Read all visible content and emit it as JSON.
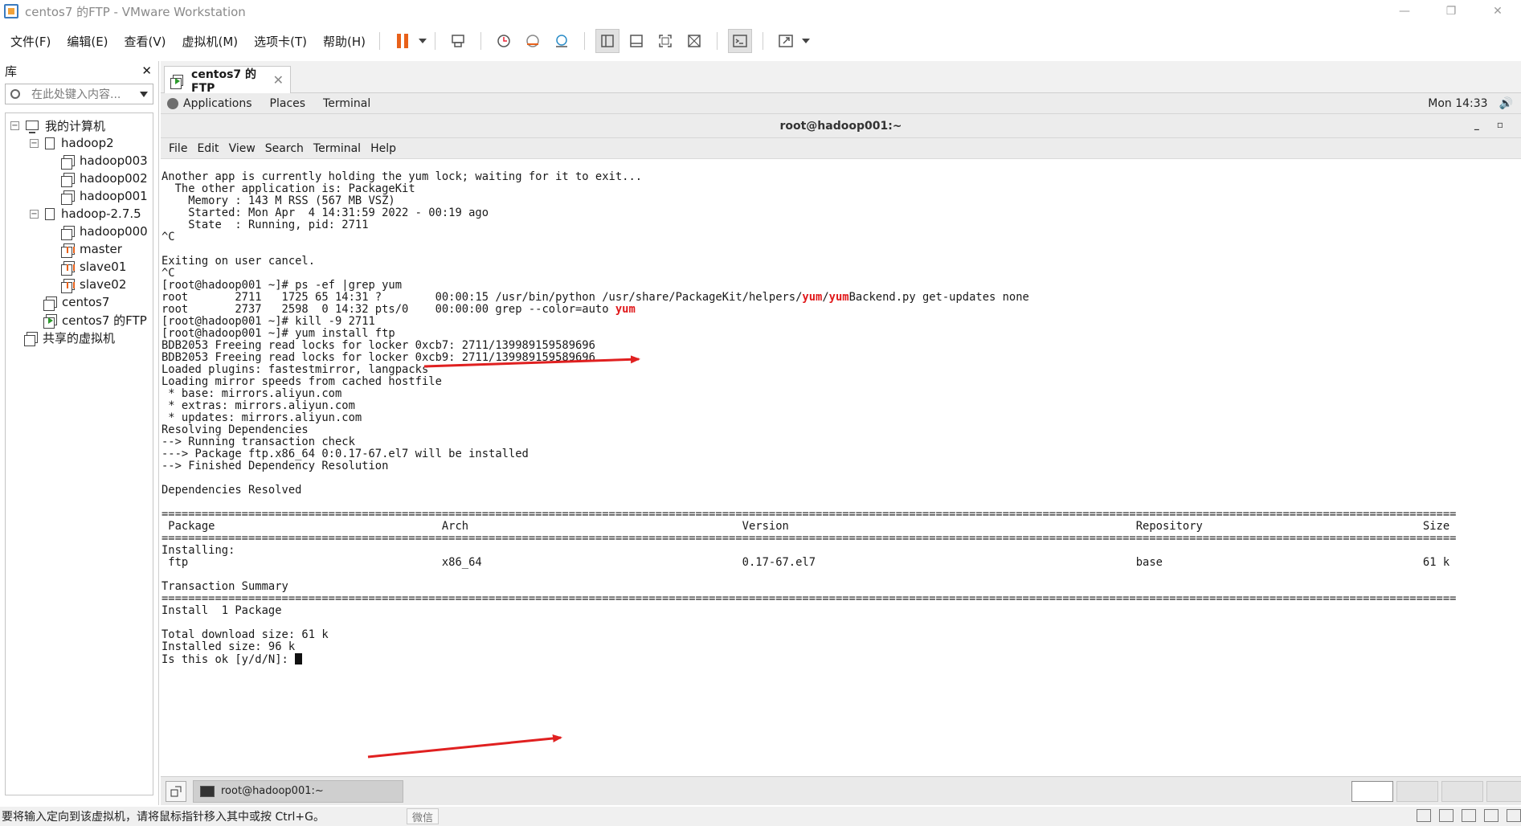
{
  "window": {
    "title": "centos7 的FTP - VMware Workstation",
    "minimize": "—",
    "restore": "❐",
    "close": "✕"
  },
  "menu": {
    "items": [
      "文件(F)",
      "编辑(E)",
      "查看(V)",
      "虚拟机(M)",
      "选项卡(T)",
      "帮助(H)"
    ]
  },
  "toolbar": {
    "icons": [
      "pause-icon",
      "send-ctrl-alt-del-icon",
      "snapshot-icon",
      "revert-snapshot-icon",
      "snapshot-manager-icon",
      "library-view-icon",
      "thumbnail-bar-icon",
      "fullscreen-icon",
      "unity-icon",
      "console-view-icon",
      "stretch-icon"
    ]
  },
  "library": {
    "title": "库",
    "close": "✕",
    "search_placeholder": "在此处键入内容...",
    "tree": {
      "root": "我的计算机",
      "groups": [
        {
          "label": "hadoop2",
          "items": [
            "hadoop003",
            "hadoop002",
            "hadoop001"
          ]
        },
        {
          "label": "hadoop-2.7.5",
          "items": [
            "hadoop000",
            "master",
            "slave01",
            "slave02"
          ]
        }
      ],
      "loose": [
        "centos7",
        "centos7 的FTP"
      ],
      "shared": "共享的虚拟机"
    }
  },
  "tab": {
    "label": "centos7 的FTP",
    "close": "✕"
  },
  "guest": {
    "top_bar": {
      "applications": "Applications",
      "places": "Places",
      "terminal": "Terminal",
      "clock": "Mon 14:33",
      "volume": "🔊"
    },
    "terminal_window": {
      "title": "root@hadoop001:~",
      "minimize": "_",
      "maximize": "▫",
      "menu": [
        "File",
        "Edit",
        "View",
        "Search",
        "Terminal",
        "Help"
      ]
    },
    "terminal_lines": {
      "l1": "Another app is currently holding the yum lock; waiting for it to exit...",
      "l2": "  The other application is: PackageKit",
      "l3": "    Memory : 143 M RSS (567 MB VSZ)",
      "l4": "    Started: Mon Apr  4 14:31:59 2022 - 00:19 ago",
      "l5": "    State  : Running, pid: 2711",
      "l6": "^C",
      "l7": "",
      "l8": "Exiting on user cancel.",
      "l9": "^C",
      "l10": "[root@hadoop001 ~]# ps -ef |grep yum",
      "l11a": "root       2711   1725 65 14:31 ?        00:00:15 /usr/bin/python /usr/share/PackageKit/helpers/",
      "l11b": "yum",
      "l11c": "/",
      "l11d": "yum",
      "l11e": "Backend.py get-updates none",
      "l12a": "root       2737   2598  0 14:32 pts/0    00:00:00 grep --color=auto ",
      "l12b": "yum",
      "l13": "[root@hadoop001 ~]# kill -9 2711",
      "l14": "[root@hadoop001 ~]# yum install ftp",
      "l15": "BDB2053 Freeing read locks for locker 0xcb7: 2711/139989159589696",
      "l16": "BDB2053 Freeing read locks for locker 0xcb9: 2711/139989159589696",
      "l17": "Loaded plugins: fastestmirror, langpacks",
      "l18": "Loading mirror speeds from cached hostfile",
      "l19": " * base: mirrors.aliyun.com",
      "l20": " * extras: mirrors.aliyun.com",
      "l21": " * updates: mirrors.aliyun.com",
      "l22": "Resolving Dependencies",
      "l23": "--> Running transaction check",
      "l24": "---> Package ftp.x86_64 0:0.17-67.el7 will be installed",
      "l25": "--> Finished Dependency Resolution",
      "l26": "",
      "l27": "Dependencies Resolved",
      "l28": "",
      "l29": "==================================================================================================================================================================================================",
      "l30": " Package                                  Arch                                         Version                                                    Repository                                 Size",
      "l31": "==================================================================================================================================================================================================",
      "l32": "Installing:",
      "l33": " ftp                                      x86_64                                       0.17-67.el7                                                base                                       61 k",
      "l34": "",
      "l35": "Transaction Summary",
      "l36": "==================================================================================================================================================================================================",
      "l37": "Install  1 Package",
      "l38": "",
      "l39": "Total download size: 61 k",
      "l40": "Installed size: 96 k",
      "l41": "Is this ok [y/d/N]: "
    },
    "taskbar": {
      "task_label": "root@hadoop001:~"
    }
  },
  "status": {
    "message": "要将输入定向到该虚拟机，请将鼠标指针移入其中或按 Ctrl+G。",
    "chip": "微信"
  },
  "annotations": {
    "arrow_color": "#e02020"
  }
}
